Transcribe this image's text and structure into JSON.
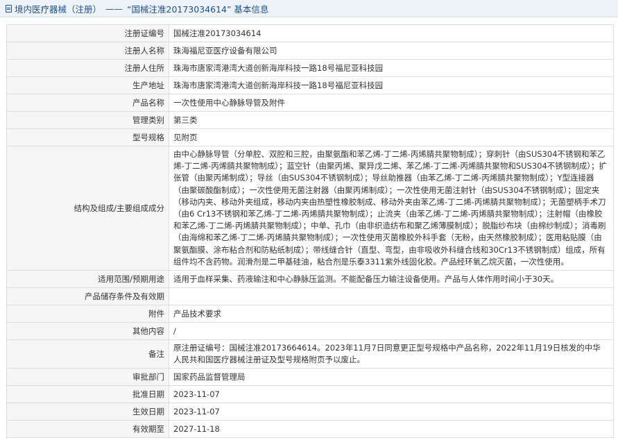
{
  "header": {
    "category": "境内医疗器械（注册）",
    "separator": "——",
    "title": "“国械注准20173034614” 基本信息"
  },
  "rows": [
    {
      "label": "注册证编号",
      "value": "国械注准20173034614"
    },
    {
      "label": "注册人名称",
      "value": "珠海福尼亚医疗设备有限公司"
    },
    {
      "label": "注册人住所",
      "value": "珠海市唐家湾港湾大道创新海岸科技一路18号福尼亚科技园"
    },
    {
      "label": "生产地址",
      "value": "珠海市唐家湾港湾大道创新海岸科技一路18号福尼亚科技园"
    },
    {
      "label": "产品名称",
      "value": "一次性使用中心静脉导管及附件"
    },
    {
      "label": "管理类别",
      "value": "第三类"
    },
    {
      "label": "型号规格",
      "value": "见附页"
    },
    {
      "label": "结构及组成/主要组成成分",
      "value": "由中心静脉导管（分单腔、双腔和三腔，由聚氨酯和苯乙烯-丁二烯-丙烯腈共聚物制成）；穿刺针（由SUS304不锈钢和苯乙烯-丁二烯-丙烯腈共聚物制成）；蓝空针（由聚丙烯、聚异戊二烯、苯乙烯-丁二烯-丙烯腈共聚物和SUS304不锈钢制成）；扩张管（由聚丙烯制成）；导丝（由SUS304不锈钢制成）；导丝助推器（由苯乙烯-丁二烯-丙烯腈共聚物制成）；Y型连接器（由聚碳酸酯制成）；一次性使用无菌注射器（由聚丙烯制成）；一次性使用无菌注射针（由SUS304不锈钢制成）；固定夹（移动内夹、移动外夹组成，移动内夹由热塑性橡胶制成、移动外夹由苯乙烯-丁二烯-丙烯腈共聚物制成）；无菌塑柄手术刀（由6 Cr13不锈钢和苯乙烯-丁二烯-丙烯腈共聚物制成）；止流夹（由苯乙烯-丁二烯-丙烯腈共聚物制成）；注射帽（由橡胶和苯乙烯-丁二烯-丙烯腈共聚物制成）；中单、孔巾（由非织造纺布和聚乙烯薄膜制成）；脱脂纱布块（由棉纱制成）；消毒刷（由海绵和苯乙烯-丁二烯-丙烯腈共聚物制成）；一次性使用灭菌橡胶外科手套（无粉，由天然橡胶制成）；医用粘贴膜（由聚氨酯膜、涂布粘合剂和防粘纸制成）；带线缝合针（直型、弯型，由非吸收外科缝合线和30Cr13不锈钢制成）组成，所有组件均不含药物。润滑剂是二甲基硅油，粘合剂是乐泰3311紫外线固化胶。产品经环氧乙烷灭菌，一次性使用。"
    },
    {
      "label": "适用范围/预期用途",
      "value": "适用于血样采集、药液输注和中心静脉压监测。不能配备压力输注设备使用。产品与人体作用时间小于30天。"
    },
    {
      "label": "产品储存条件及有效期",
      "value": ""
    },
    {
      "label": "附件",
      "value": "产品技术要求"
    },
    {
      "label": "其他内容",
      "value": "/"
    },
    {
      "label": "备注",
      "value": "原注册证编号：国械注准20173664614。2023年11月7日同意更正型号规格中产品名称，2022年11月19日核发的中华人民共和国医疗器械注册证及型号规格附页予以废止。"
    },
    {
      "label": "审批部门",
      "value": "国家药品监督管理局"
    },
    {
      "label": "批准日期",
      "value": "2023-11-07"
    },
    {
      "label": "生效日期",
      "value": "2023-11-07"
    },
    {
      "label": "有效期至",
      "value": "2027-11-18"
    }
  ]
}
